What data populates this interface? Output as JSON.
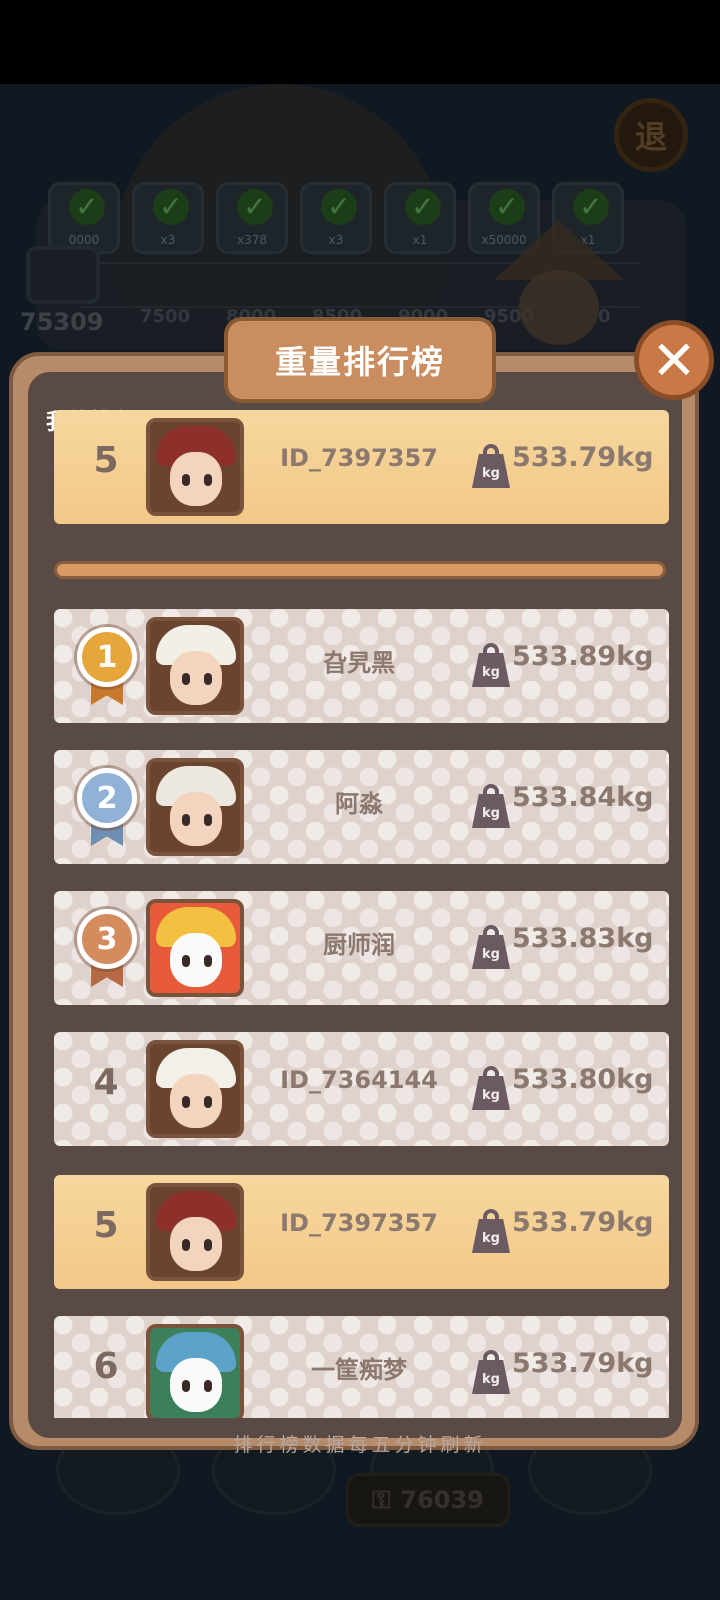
{
  "background": {
    "exit_button_label": "退",
    "reward_counts": [
      "0000",
      "x3",
      "x378",
      "x3",
      "x1",
      "x50000",
      "x1"
    ],
    "track_values": [
      "7500",
      "8000",
      "8500",
      "9000",
      "9500",
      "0"
    ],
    "score_left": "75309",
    "bottom_currency": "76039"
  },
  "modal": {
    "title": "重量排行榜",
    "my_rank_label": "我的排名",
    "footer_note": "排行榜数据每五分钟刷新"
  },
  "my_rank": {
    "rank": "5",
    "name": "ID_7397357",
    "weight": "533.79kg"
  },
  "kg_label": "kg",
  "leaderboard": [
    {
      "rank": "1",
      "name": "旮旯黑",
      "weight": "533.89kg",
      "medal": "gold"
    },
    {
      "rank": "2",
      "name": "阿淼",
      "weight": "533.84kg",
      "medal": "silver"
    },
    {
      "rank": "3",
      "name": "厨师润",
      "weight": "533.83kg",
      "medal": "bronze"
    },
    {
      "rank": "4",
      "name": "ID_7364144",
      "weight": "533.80kg",
      "medal": ""
    },
    {
      "rank": "5",
      "name": "ID_7397357",
      "weight": "533.79kg",
      "medal": "",
      "highlight": true
    },
    {
      "rank": "6",
      "name": "一筐痴梦",
      "weight": "533.79kg",
      "medal": ""
    }
  ],
  "colors": {
    "gold": "#e7a63c",
    "silver": "#8fb2d6",
    "bronze": "#d48b5e",
    "ribbon_gold": "#c9792d",
    "ribbon_silver": "#6f8fb2",
    "ribbon_bronze": "#b76b44",
    "highlight_row": "#f6d79e"
  }
}
